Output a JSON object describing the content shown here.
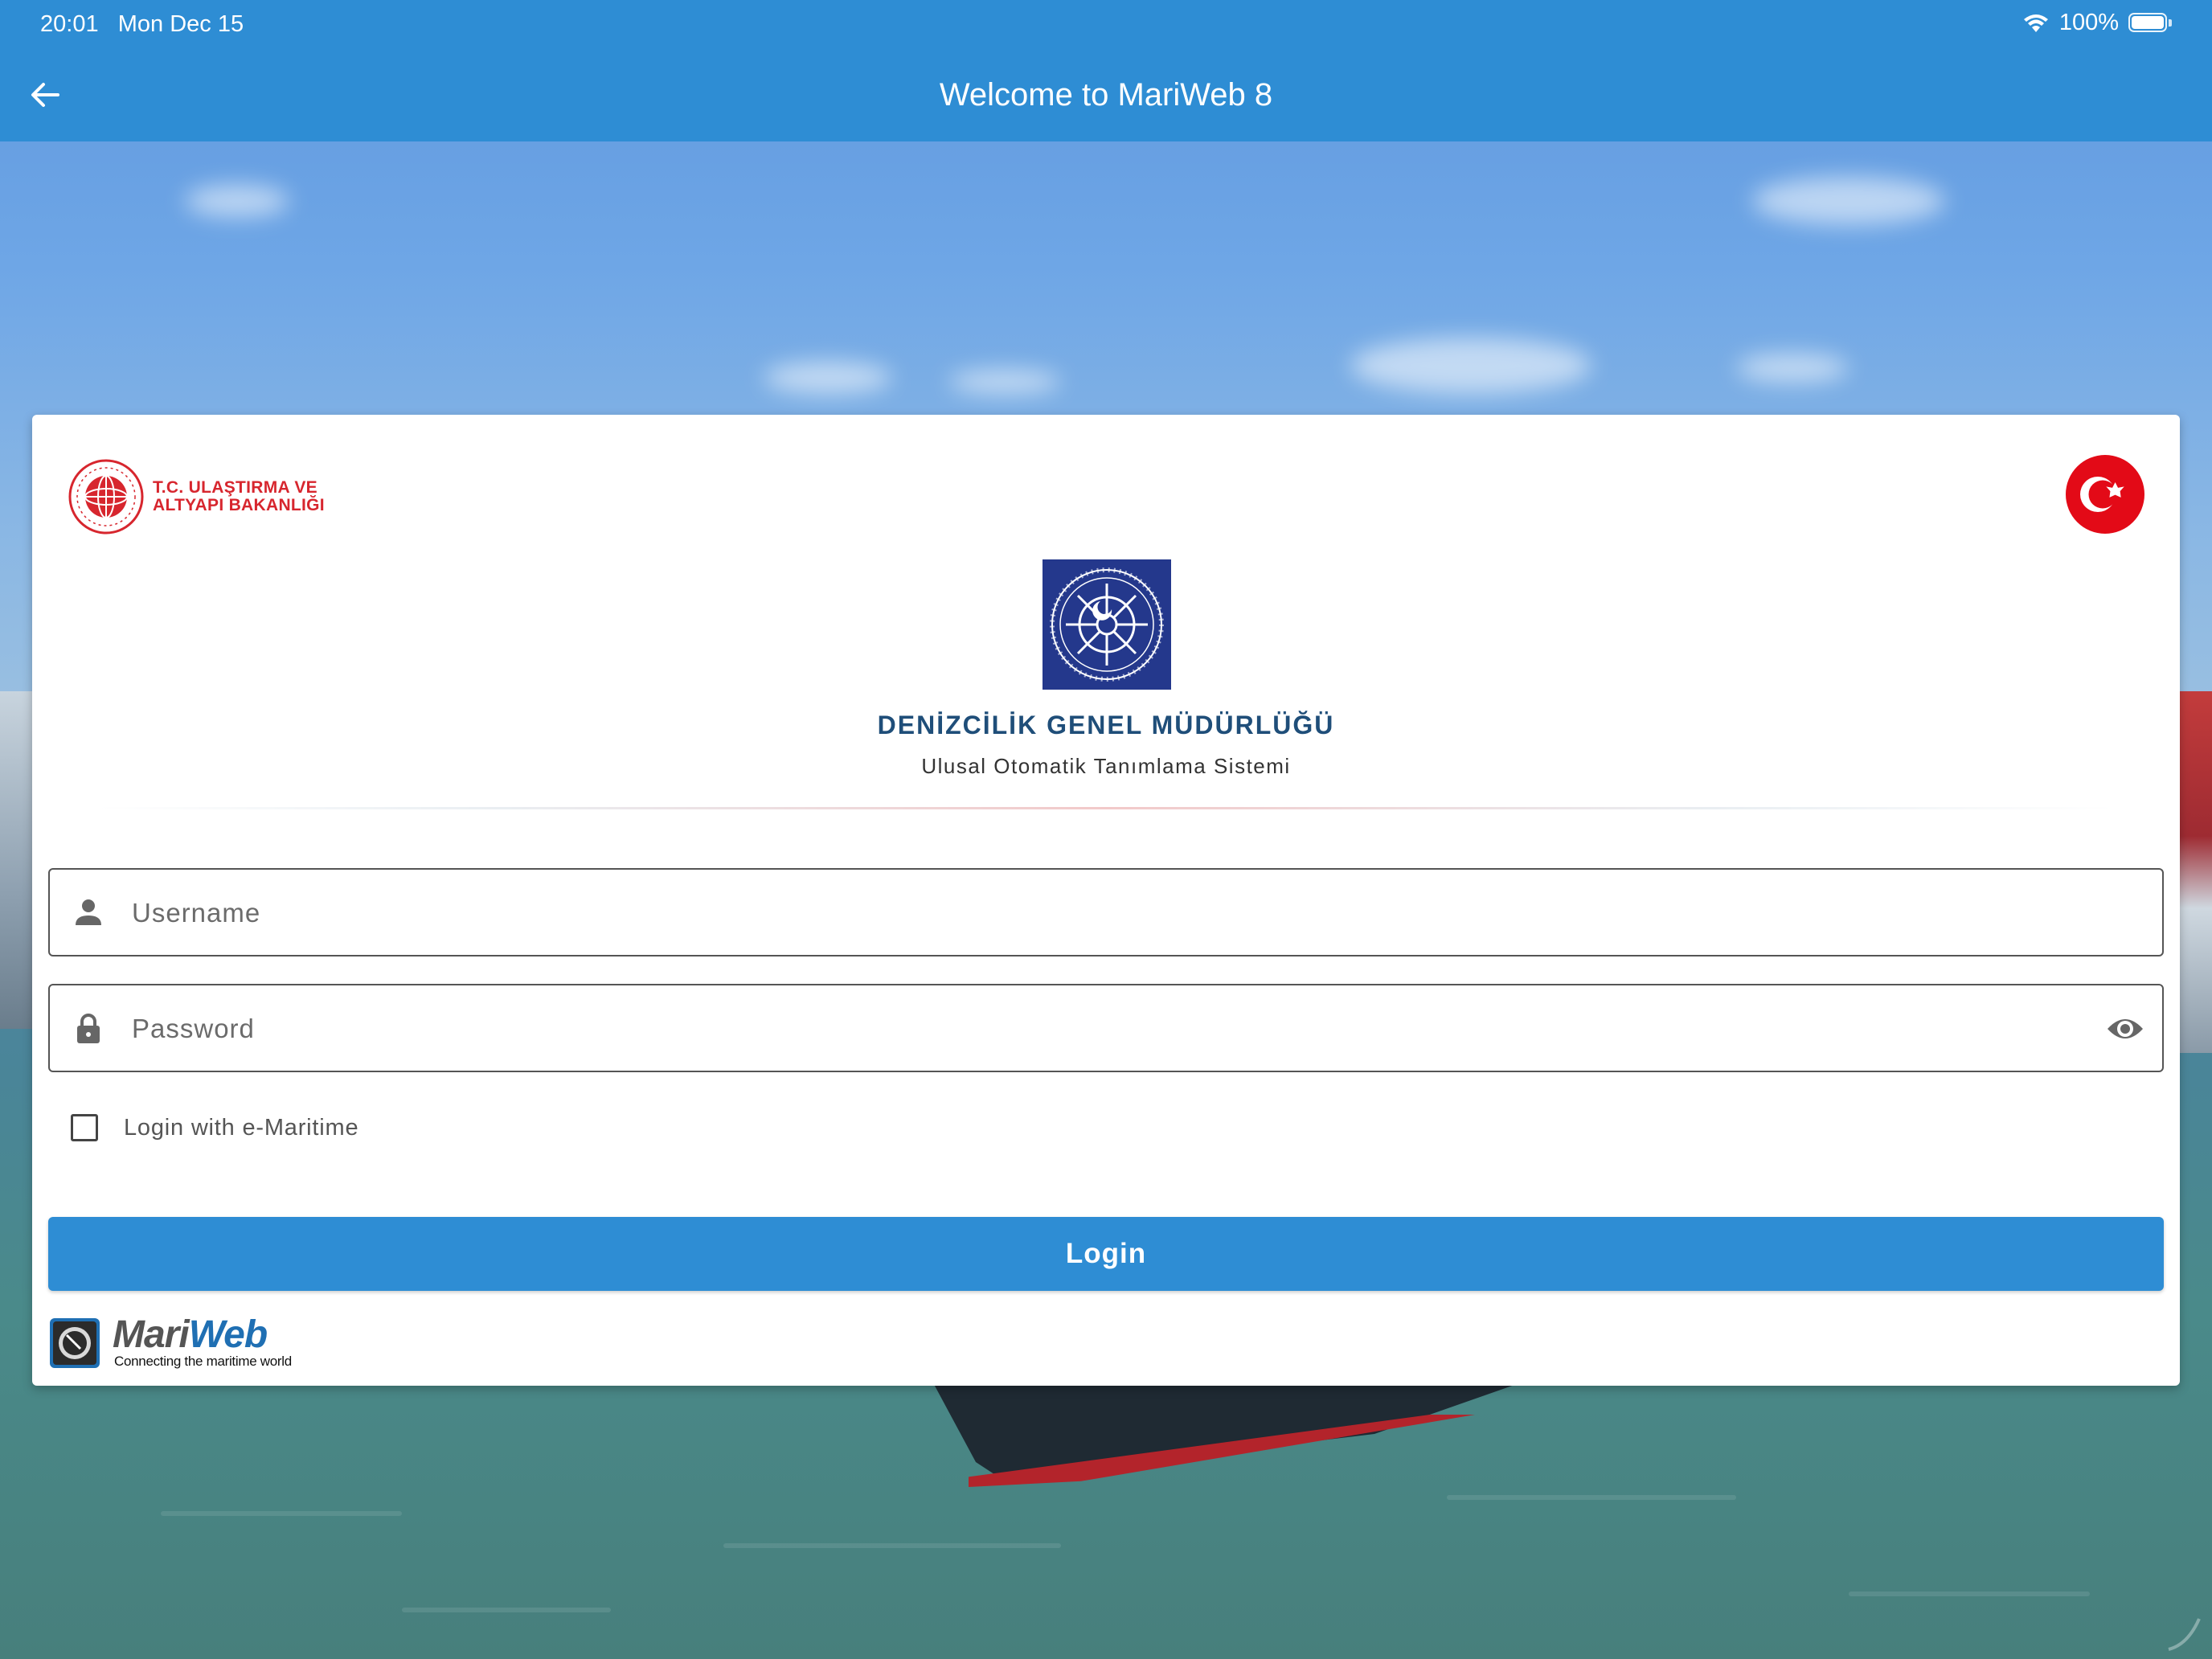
{
  "status_bar": {
    "time": "20:01",
    "date": "Mon Dec 15",
    "battery": "100%"
  },
  "app_bar": {
    "title": "Welcome to MariWeb 8",
    "back_icon": "arrow-left-icon"
  },
  "header": {
    "ministry_line1": "T.C. ULAŞTIRMA VE",
    "ministry_line2": "ALTYAPI BAKANLIĞI",
    "flag_icon": "turkey-flag-icon",
    "emblem_icon": "dgm-emblem-icon"
  },
  "organization": {
    "title": "DENİZCİLİK GENEL MÜDÜRLÜĞÜ",
    "subtitle": "Ulusal Otomatik Tanımlama Sistemi"
  },
  "form": {
    "username": {
      "placeholder": "Username",
      "value": "",
      "icon": "person-icon"
    },
    "password": {
      "placeholder": "Password",
      "value": "",
      "icon": "lock-icon",
      "toggle_icon": "eye-icon"
    },
    "emaritime_checkbox": {
      "label": "Login with e-Maritime",
      "checked": false
    },
    "login_label": "Login"
  },
  "footer": {
    "brand_mari": "Mari",
    "brand_web": "Web",
    "tagline": "Connecting the maritime world"
  },
  "colors": {
    "primary": "#2e8dd4",
    "org_title": "#1f4e79",
    "ministry_red": "#d7262e"
  }
}
